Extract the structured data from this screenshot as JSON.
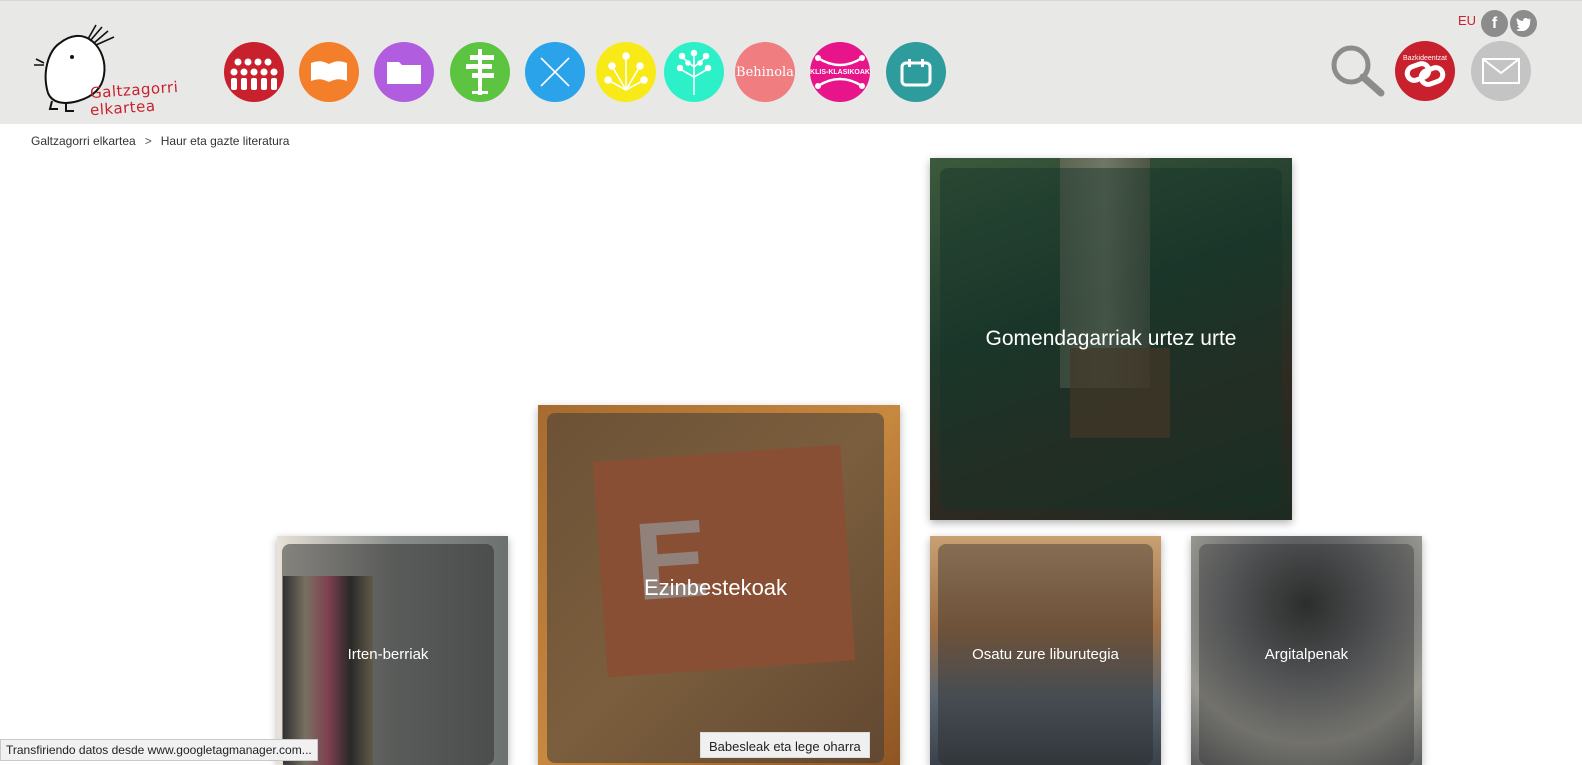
{
  "header": {
    "logo_line1": "Galtzagorri",
    "logo_line2": "elkartea",
    "lang": "EU",
    "nav_icons": [
      {
        "name": "people-icon",
        "color": "#c8202d"
      },
      {
        "name": "open-book-icon",
        "color": "#f47f2a"
      },
      {
        "name": "folder-icon",
        "color": "#b05de0"
      },
      {
        "name": "signpost-icon",
        "color": "#5cc440"
      },
      {
        "name": "cross-icon",
        "color": "#2aa3ea"
      },
      {
        "name": "sparkle-icon",
        "color": "#f8ea18"
      },
      {
        "name": "tree-icon",
        "color": "#2cf0c8"
      },
      {
        "name": "behinola-logo",
        "color": "#f07d80",
        "text": "Behinola"
      },
      {
        "name": "klis-klasikoak-logo",
        "color": "#e8158a",
        "text": "KLIS-KLASIKOAK"
      },
      {
        "name": "calendar-icon",
        "color": "#2e9c9c"
      }
    ],
    "tools": {
      "search": "search-icon",
      "bazkideentzat": {
        "color": "#c8202d",
        "text": "Bazkideentzat"
      },
      "mail": {
        "color": "#c4c4c4"
      }
    }
  },
  "breadcrumb": {
    "home": "Galtzagorri elkartea",
    "separator": ">",
    "current": "Haur eta gazte literatura"
  },
  "tiles": {
    "gomendagarriak": "Gomendagarriak urtez urte",
    "ezinbestekoak": "Ezinbestekoak",
    "irten_berriak": "Irten-berriak",
    "osatu": "Osatu zure liburutegia",
    "argitalpenak": "Argitalpenak"
  },
  "legal_label": "Babesleak eta lege oharra",
  "status_text": "Transfiriendo datos desde www.googletagmanager.com..."
}
